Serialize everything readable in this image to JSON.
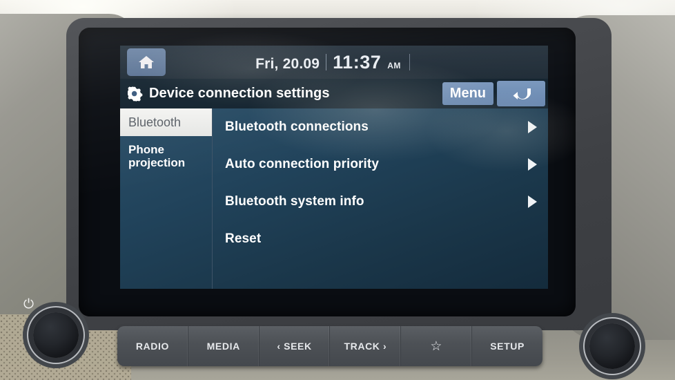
{
  "status_bar": {
    "home_icon": "home-icon",
    "date": "Fri, 20.09",
    "time": "11:37",
    "ampm": "AM"
  },
  "title_bar": {
    "icon": "gear-icon",
    "title": "Device connection settings",
    "menu_label": "Menu",
    "back_icon": "back-arrow-icon"
  },
  "sidebar": {
    "items": [
      {
        "label": "Bluetooth",
        "selected": true
      },
      {
        "label": "Phone projection",
        "selected": false
      }
    ]
  },
  "menu_list": {
    "items": [
      {
        "label": "Bluetooth connections",
        "has_arrow": true
      },
      {
        "label": "Auto connection priority",
        "has_arrow": true
      },
      {
        "label": "Bluetooth system info",
        "has_arrow": true
      },
      {
        "label": "Reset",
        "has_arrow": false
      }
    ]
  },
  "hardware_buttons": [
    {
      "label": "RADIO",
      "name": "radio"
    },
    {
      "label": "MEDIA",
      "name": "media"
    },
    {
      "label": "‹ SEEK",
      "name": "seek"
    },
    {
      "label": "TRACK ›",
      "name": "track"
    },
    {
      "label": "☆",
      "name": "favorite"
    },
    {
      "label": "SETUP",
      "name": "setup"
    }
  ],
  "knobs": {
    "left_label": "⏻",
    "left_name": "power-volume-knob",
    "right_name": "tune-scroll-knob"
  },
  "colors": {
    "accent_blue": "#6585ae",
    "title_blue": "#44658c",
    "content_bg": "#1a3649",
    "sidebar_bg": "#2a3c4c",
    "selected_bg": "#eceded",
    "text_white": "#ffffff"
  }
}
